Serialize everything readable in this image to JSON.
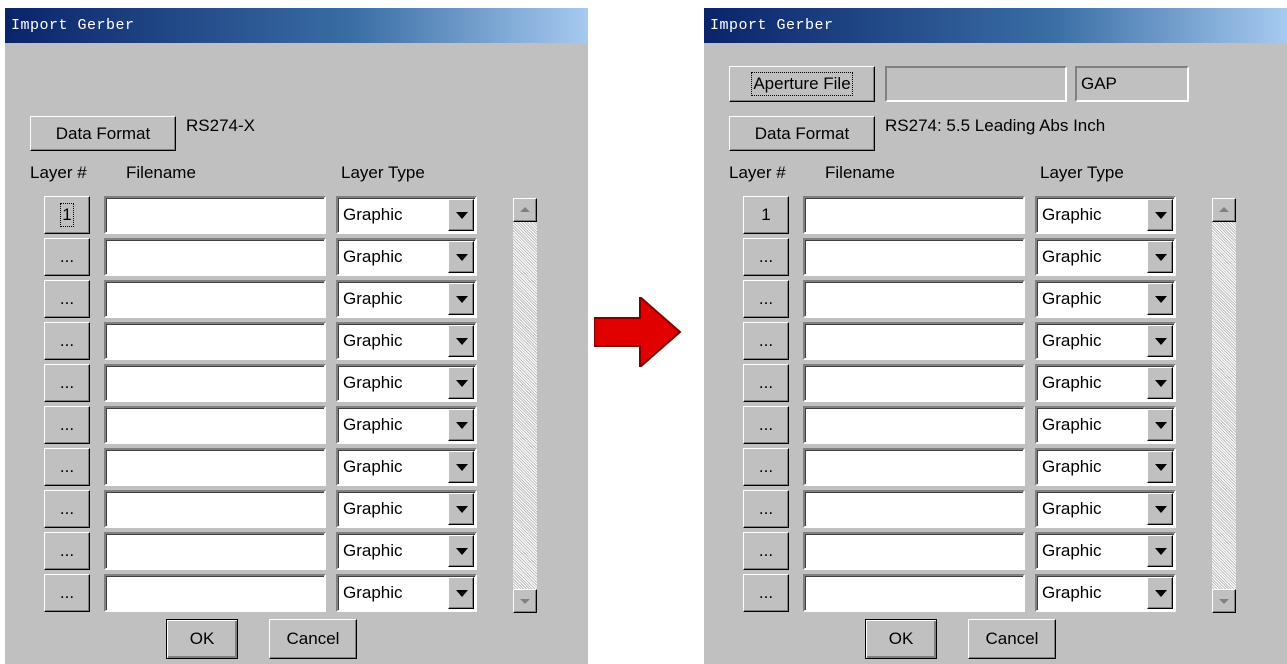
{
  "colors": {
    "arrow": "#e00000",
    "titlebar_start": "#0a246a",
    "titlebar_end": "#a6caf0",
    "face": "#c0c0c0"
  },
  "left": {
    "title": "Import Gerber",
    "data_format_label": "Data Format",
    "data_format_value": "RS274-X",
    "headers": {
      "layer": "Layer #",
      "filename": "Filename",
      "layer_type": "Layer Type"
    },
    "rows": [
      {
        "layer": "1",
        "filename": "",
        "type": "Graphic"
      },
      {
        "layer": "...",
        "filename": "",
        "type": "Graphic"
      },
      {
        "layer": "...",
        "filename": "",
        "type": "Graphic"
      },
      {
        "layer": "...",
        "filename": "",
        "type": "Graphic"
      },
      {
        "layer": "...",
        "filename": "",
        "type": "Graphic"
      },
      {
        "layer": "...",
        "filename": "",
        "type": "Graphic"
      },
      {
        "layer": "...",
        "filename": "",
        "type": "Graphic"
      },
      {
        "layer": "...",
        "filename": "",
        "type": "Graphic"
      },
      {
        "layer": "...",
        "filename": "",
        "type": "Graphic"
      },
      {
        "layer": "...",
        "filename": "",
        "type": "Graphic"
      }
    ],
    "ok_label": "OK",
    "cancel_label": "Cancel"
  },
  "right": {
    "title": "Import Gerber",
    "aperture_file_label": "Aperture File",
    "aperture_file_value": "",
    "aperture_ext": "GAP",
    "data_format_label": "Data Format",
    "data_format_value": "RS274: 5.5 Leading Abs Inch",
    "headers": {
      "layer": "Layer #",
      "filename": "Filename",
      "layer_type": "Layer Type"
    },
    "rows": [
      {
        "layer": "1",
        "filename": "",
        "type": "Graphic"
      },
      {
        "layer": "...",
        "filename": "",
        "type": "Graphic"
      },
      {
        "layer": "...",
        "filename": "",
        "type": "Graphic"
      },
      {
        "layer": "...",
        "filename": "",
        "type": "Graphic"
      },
      {
        "layer": "...",
        "filename": "",
        "type": "Graphic"
      },
      {
        "layer": "...",
        "filename": "",
        "type": "Graphic"
      },
      {
        "layer": "...",
        "filename": "",
        "type": "Graphic"
      },
      {
        "layer": "...",
        "filename": "",
        "type": "Graphic"
      },
      {
        "layer": "...",
        "filename": "",
        "type": "Graphic"
      },
      {
        "layer": "...",
        "filename": "",
        "type": "Graphic"
      }
    ],
    "ok_label": "OK",
    "cancel_label": "Cancel"
  }
}
